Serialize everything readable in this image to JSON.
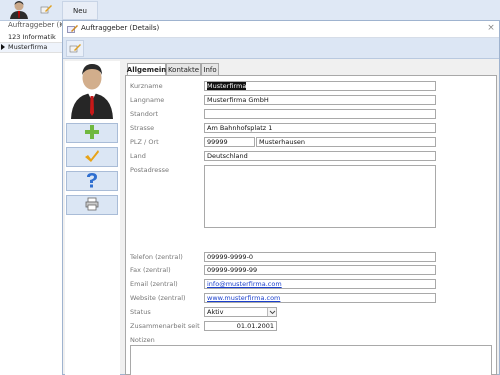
{
  "toolbar": {
    "new_label": "Neu"
  },
  "list": {
    "header": "Auftraggeber (Kur",
    "rows": [
      "123 Informatik",
      "Musterfirma"
    ]
  },
  "dialog": {
    "title": "Auftraggeber (Details)",
    "close": "×",
    "tabs": [
      "Allgemein",
      "Kontakte",
      "Info"
    ],
    "active_tab": "Allgemein",
    "fields": {
      "kurzname": {
        "label": "Kurzname",
        "value": "Musterfirma"
      },
      "langname": {
        "label": "Langname",
        "value": "Musterfirma GmbH"
      },
      "standort": {
        "label": "Standort",
        "value": ""
      },
      "strasse": {
        "label": "Strasse",
        "value": "Am Bahnhofsplatz 1"
      },
      "plz_ort": {
        "label": "PLZ / Ort",
        "plz": "99999",
        "ort": "Musterhausen"
      },
      "land": {
        "label": "Land",
        "value": "Deutschland"
      },
      "postadresse": {
        "label": "Postadresse",
        "value": ""
      },
      "telefon": {
        "label": "Telefon (zentral)",
        "value": "09999-9999-0"
      },
      "fax": {
        "label": "Fax (zentral)",
        "value": "09999-9999-99"
      },
      "email": {
        "label": "Email (zentral)",
        "value": "info@musterfirma.com"
      },
      "website": {
        "label": "Website (zentral)",
        "value": "www.musterfirma.com"
      },
      "status": {
        "label": "Status",
        "value": "Aktiv"
      },
      "zusammenarbeit": {
        "label": "Zusammenarbeit seit",
        "value": "01.01.2001"
      },
      "notizen": {
        "label": "Notizen",
        "value": ""
      }
    },
    "side_buttons": [
      "add-icon",
      "checkmark-icon",
      "help-icon",
      "print-icon"
    ]
  },
  "colors": {
    "add": "#6fb83f",
    "check": "#e8a317",
    "help": "#2f6fd0",
    "accent": "#dce6f4"
  }
}
